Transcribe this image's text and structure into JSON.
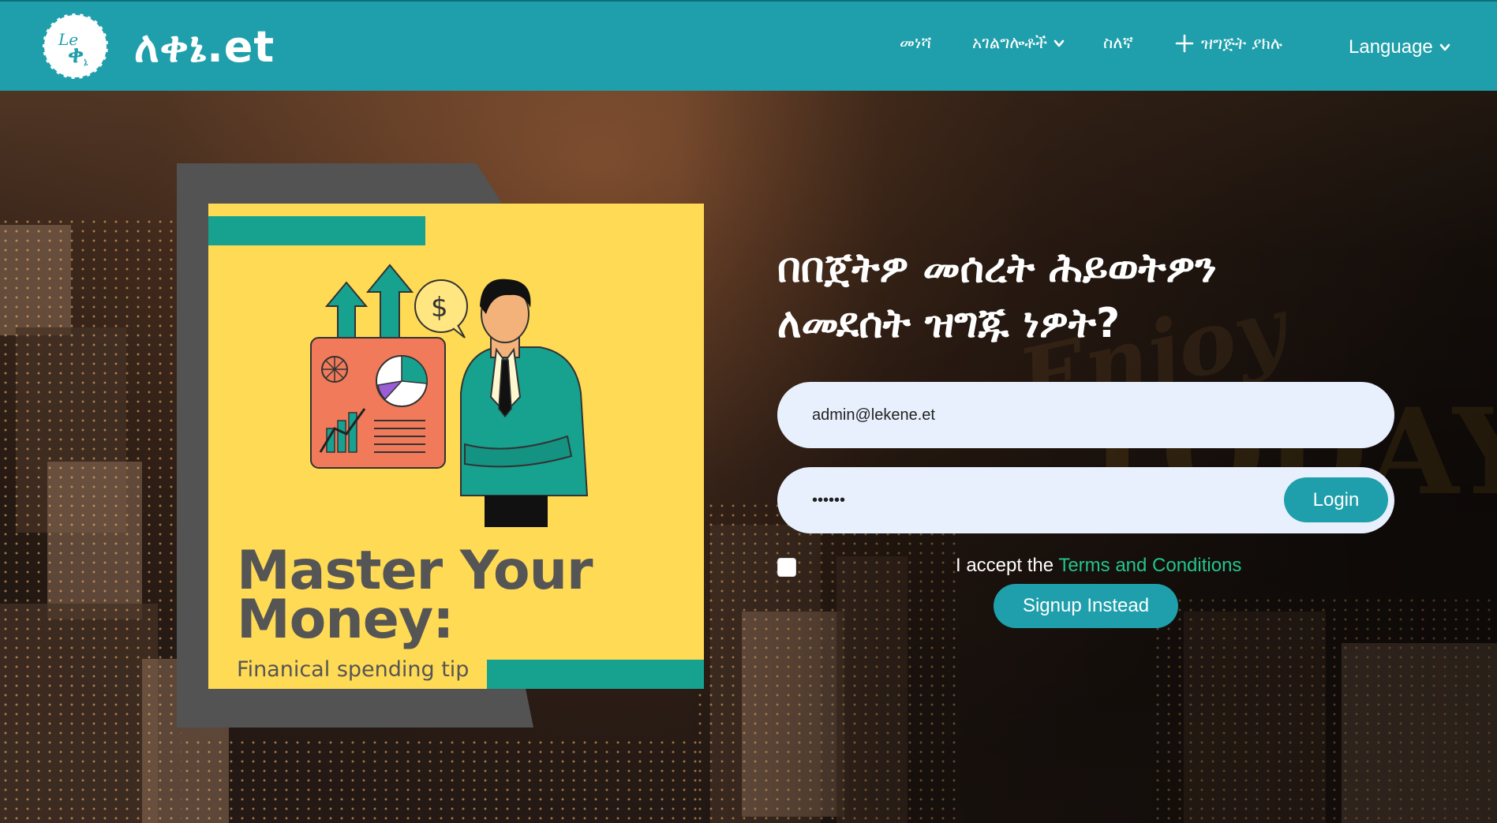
{
  "brand": {
    "logo_icon": "lekene-logo-icon",
    "name": "ለቀኔ.et"
  },
  "nav": {
    "home": "መነሻ",
    "services": "አገልግሎቶች",
    "about": "ስለኛ",
    "add_budget": "ዝግጅት ያክሉ",
    "language": "Language"
  },
  "poster": {
    "title_line1": "Master Your",
    "title_line2": "Money:",
    "subtitle": "Finanical spending tip"
  },
  "form": {
    "headline_line1": "በበጀትዎ መሰረት ሕይወትዎን",
    "headline_line2": "ለመደሰት ዝግጁ ነዎት?",
    "email_value": "admin@lekene.et",
    "password_value": "••••••",
    "login_label": "Login",
    "terms_prefix": "I accept the ",
    "terms_link": "Terms and Conditions",
    "signup_label": "Signup Instead"
  },
  "colors": {
    "header": "#1f9fab",
    "button": "#1f9fab",
    "link": "#23c48e",
    "input_bg": "#e8f0fe",
    "poster_yellow": "#ffda55",
    "poster_teal": "#17a18f"
  }
}
